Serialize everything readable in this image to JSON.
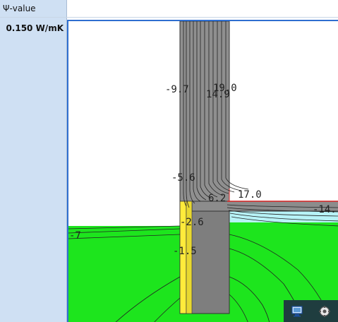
{
  "header": {
    "label": "Ψ-value"
  },
  "result": {
    "value": "0.150 W/mK"
  },
  "isotherm_labels": {
    "a": "-9.7",
    "b": "19.0",
    "c": "14.9",
    "d": "-5.6",
    "e": "6.2",
    "f": "17.0",
    "g": "-14.",
    "h": "-2.6",
    "i": "-1.5",
    "j": "-7"
  },
  "toolbar": {
    "monitor_icon": "monitor-icon",
    "gear_icon": "settings-icon"
  },
  "colors": {
    "panel": "#cfe0f3",
    "wall": "#8f8f8f",
    "ground": "#1de51d",
    "insulation": "#ffeb3b",
    "frame": "#2f6fd0"
  }
}
